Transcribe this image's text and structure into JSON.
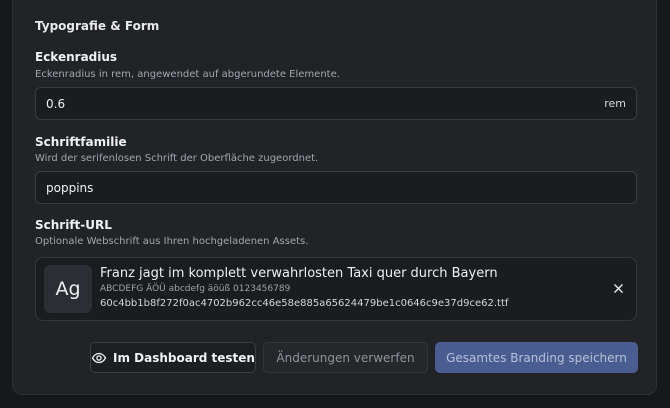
{
  "section": {
    "title": "Typografie & Form"
  },
  "radius": {
    "label": "Eckenradius",
    "hint": "Eckenradius in rem, angewendet auf abgerundete Elemente.",
    "value": "0.6",
    "unit": "rem"
  },
  "family": {
    "label": "Schriftfamilie",
    "hint": "Wird der serifenlosen Schrift der Oberfläche zugeordnet.",
    "value": "poppins"
  },
  "font_url": {
    "label": "Schrift-URL",
    "hint": "Optionale Webschrift aus Ihren hochgeladenen Assets.",
    "badge": "Ag",
    "preview": "Franz jagt im komplett verwahrlosten Taxi quer durch Bayern",
    "charset": "ABCDEFG ÄÖÜ abcdefg äöüß 0123456789",
    "filename": "60c4bb1b8f272f0ac4702b962cc46e58e885a65624479be1c0646c9e37d9ce62.ttf",
    "remove_icon": "close-icon"
  },
  "actions": {
    "test_label": "Im Dashboard testen",
    "test_icon": "eye-icon",
    "discard_label": "Änderungen verwerfen",
    "save_label": "Gesamtes Branding speichern"
  },
  "colors": {
    "background": "#17181b",
    "panel": "#222327",
    "input": "#1b1c1f",
    "primary": "#4a5d91"
  }
}
